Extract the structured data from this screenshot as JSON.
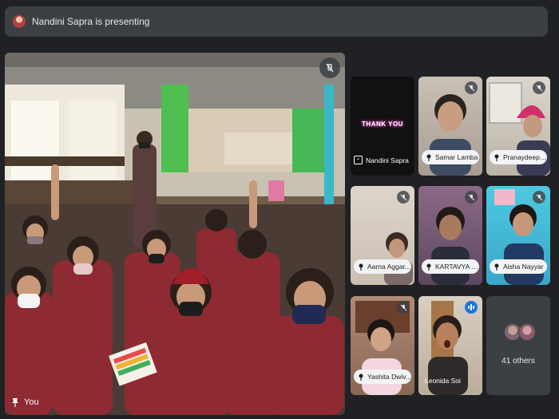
{
  "presentation_banner": {
    "text": "Nandini Sapra is presenting"
  },
  "main_tile": {
    "self_label": "You",
    "scene": "classroom-video"
  },
  "participants": [
    {
      "name": "Nandini Sapra",
      "screen_text": "THANK YOU",
      "state": "presenting"
    },
    {
      "name": "Samar Lamba",
      "state": "muted"
    },
    {
      "name": "Pranaydeep ...",
      "state": "muted"
    },
    {
      "name": "Aarna Aggar...",
      "state": "muted"
    },
    {
      "name": "KARTAVYA S...",
      "state": "muted"
    },
    {
      "name": "Aisha Nayyar",
      "state": "muted"
    },
    {
      "name": "Yashita Dwiv...",
      "state": "muted"
    },
    {
      "name": "Leonida Soi",
      "state": "speaking"
    }
  ],
  "others": {
    "label": "41 others"
  },
  "colors": {
    "background": "#202124",
    "surface": "#3c4043",
    "speaking_accent": "#1a73e8",
    "active_outline": "#8ab4f8"
  }
}
